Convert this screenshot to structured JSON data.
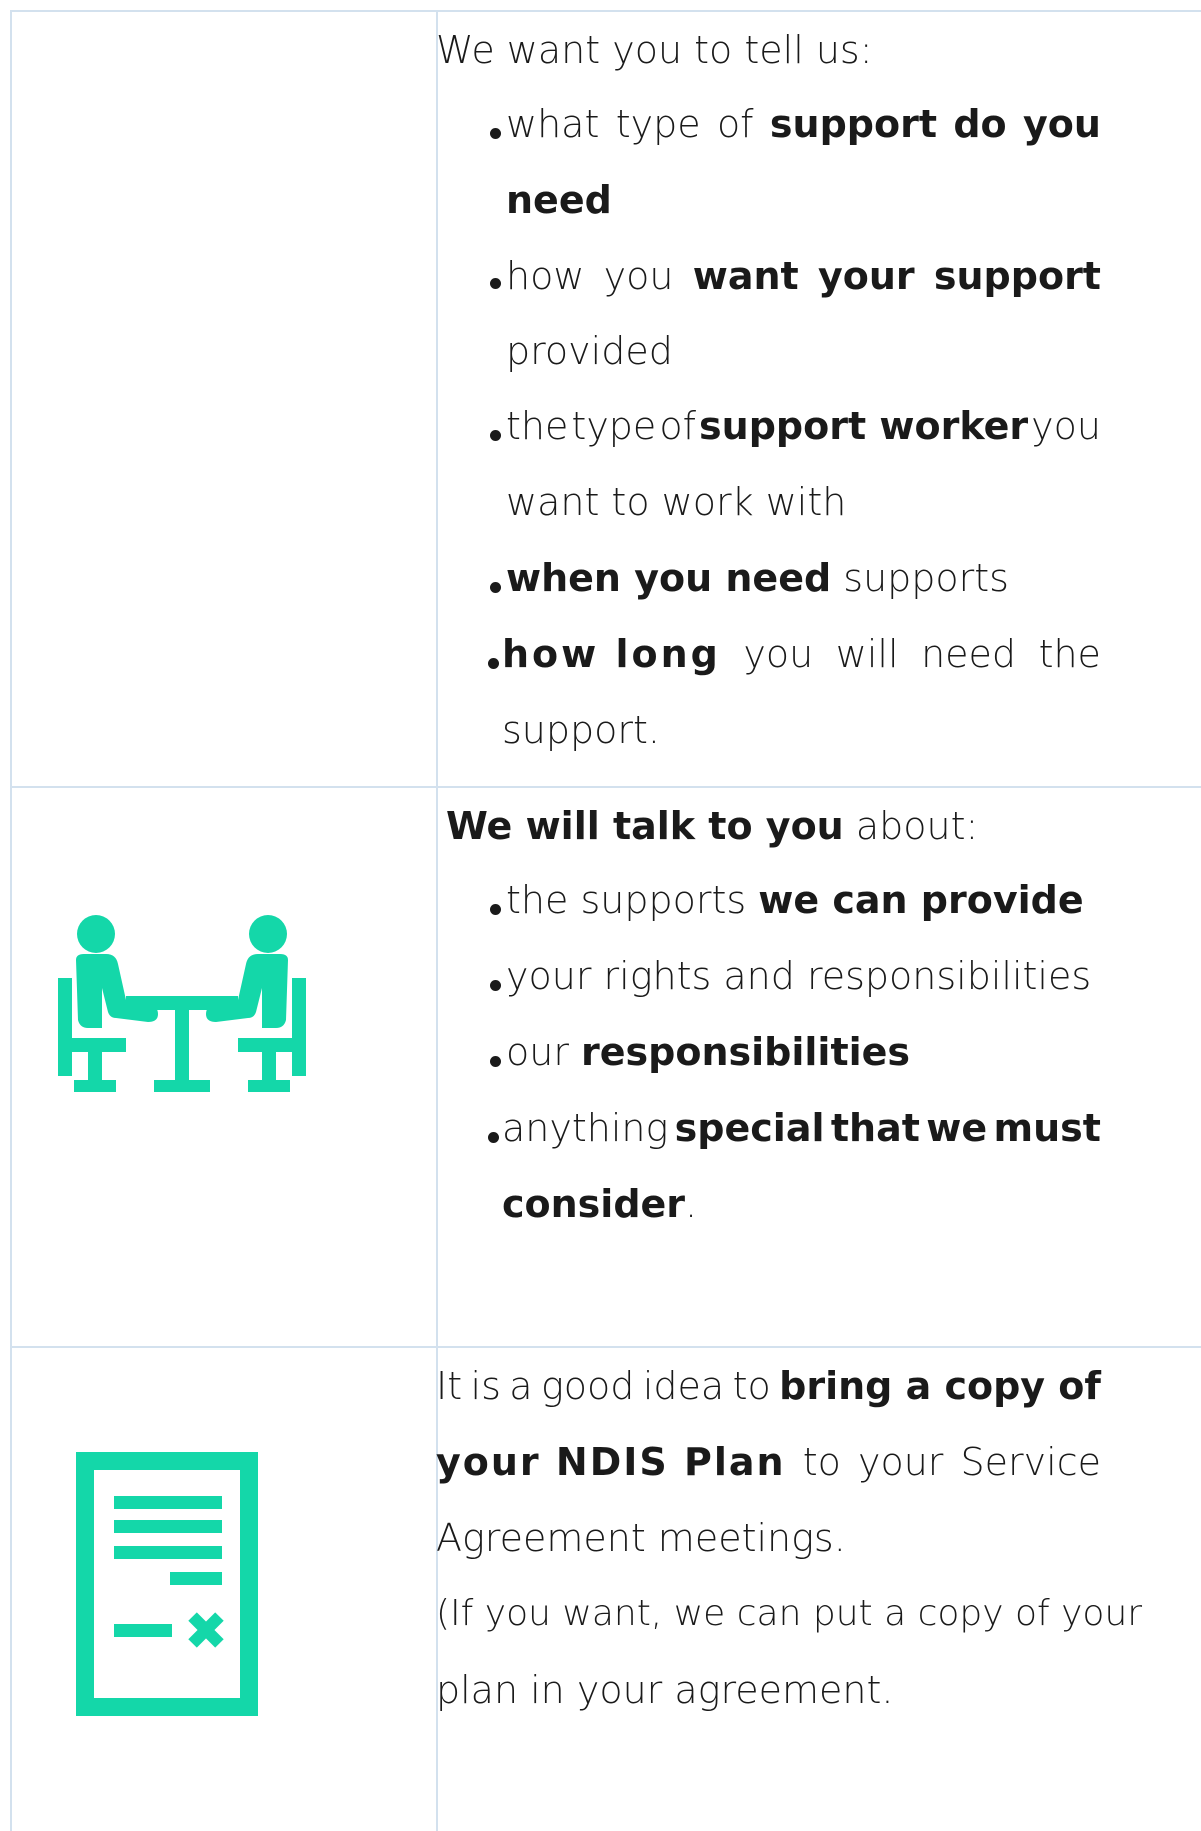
{
  "row1": {
    "intro": "We want you to tell us:",
    "b1": {
      "pre": "what",
      "mid1": "type",
      "mid2": "of",
      "bold1": "support",
      "bold2": "do",
      "bold3": "you",
      "cont": "need"
    },
    "b2": {
      "pre1": "how",
      "pre2": "you",
      "bold1": "want",
      "bold2": "your",
      "bold3": "support",
      "cont": "provided"
    },
    "b3": {
      "pre1": "the",
      "pre2": "type",
      "pre3": "of",
      "bold": "support worker",
      "post": "you",
      "cont": "want to work with"
    },
    "b4": {
      "bold": "when you need",
      "post": "supports"
    },
    "b5": {
      "bold": "how long",
      "w1": "you",
      "w2": "will",
      "w3": "need",
      "w4": "the",
      "cont": "support."
    }
  },
  "row2": {
    "intro_bold": "We will talk to you",
    "intro_rest": " about:",
    "b1": {
      "pre": "the supports ",
      "bold": "we can provide"
    },
    "b2": {
      "text": "your rights and responsibilities"
    },
    "b3": {
      "pre": "our ",
      "bold": "responsibilities"
    },
    "b4": {
      "pre": "anything",
      "bold1": "special",
      "bold2": "that",
      "bold3": "we",
      "bold4": "must",
      "cont_bold": "consider",
      "cont_rest": "."
    }
  },
  "row3": {
    "l1": {
      "w1": "It",
      "w2": "is",
      "w3": "a",
      "w4": "good",
      "w5": "idea",
      "w6": "to",
      "bold": "bring a copy of"
    },
    "l2": {
      "bold": "your NDIS Plan",
      "w1": "to",
      "w2": "your",
      "w3": "Service"
    },
    "l3": "Agreement meetings.",
    "l4": "(If you want, we can put a copy of your",
    "l5": "plan in your agreement."
  },
  "colors": {
    "accent": "#14d7a9",
    "border": "#d3e1ee",
    "text": "#1a1a1a"
  },
  "icons": [
    "meeting-icon",
    "document-icon"
  ]
}
